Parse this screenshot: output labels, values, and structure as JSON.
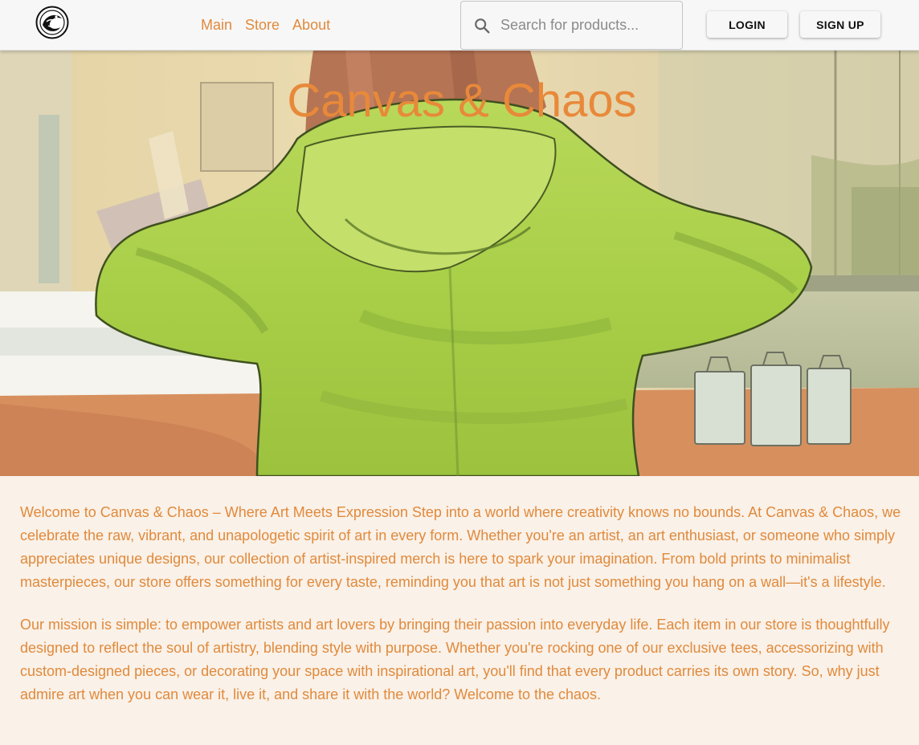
{
  "header": {
    "logo_icon": "brand-logo-icon",
    "nav": [
      {
        "label": "Main"
      },
      {
        "label": "Store"
      },
      {
        "label": "About"
      }
    ],
    "search": {
      "placeholder": "Search for products...",
      "value": "",
      "icon": "search-icon"
    },
    "login_label": "LOGIN",
    "signup_label": "SIGN UP"
  },
  "hero": {
    "title": "Canvas & Chaos",
    "image": "illustration of a person in a green hoodie at a window"
  },
  "content": {
    "paragraphs": [
      "Welcome to Canvas & Chaos – Where Art Meets Expression Step into a world where creativity knows no bounds. At Canvas & Chaos, we celebrate the raw, vibrant, and unapologetic spirit of art in every form. Whether you're an artist, an art enthusiast, or someone who simply appreciates unique designs, our collection of artist-inspired merch is here to spark your imagination. From bold prints to minimalist masterpieces, our store offers something for every taste, reminding you that art is not just something you hang on a wall—it's a lifestyle.",
      "Our mission is simple: to empower artists and art lovers by bringing their passion into everyday life. Each item in our store is thoughtfully designed to reflect the soul of artistry, blending style with purpose. Whether you're rocking one of our exclusive tees, accessorizing with custom-designed pieces, or decorating your space with inspirational art, you'll find that every product carries its own story. So, why just admire art when you can wear it, live it, and share it with the world? Welcome to the chaos."
    ]
  },
  "colors": {
    "accent": "#e08a3c",
    "page_background": "#faf1e8",
    "header_background": "#f7f7f7",
    "hoodie_green": "#a8cf48"
  }
}
